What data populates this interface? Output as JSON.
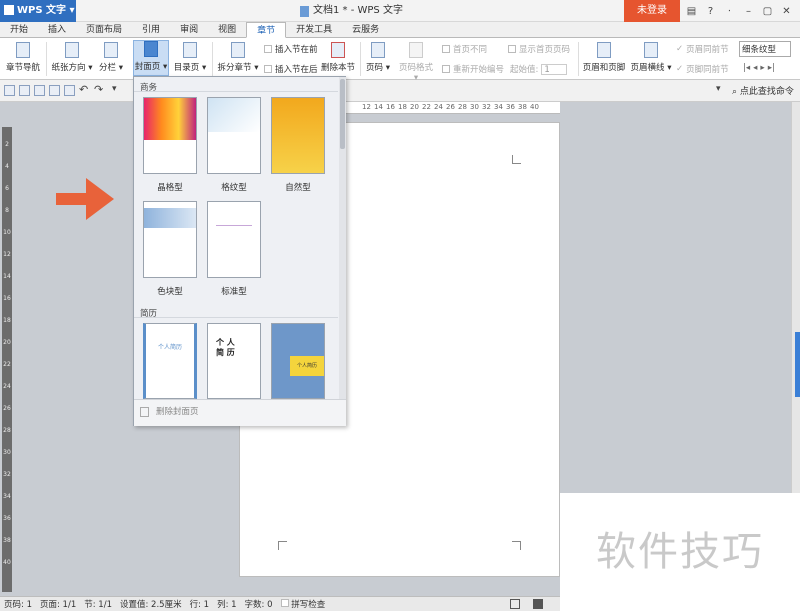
{
  "titlebar": {
    "app_name": "WPS 文字",
    "doc_title": "文档1 * - WPS 文字",
    "login": "未登录",
    "help": "?"
  },
  "tabs": [
    "开始",
    "插入",
    "页面布局",
    "引用",
    "审阅",
    "视图",
    "章节",
    "开发工具",
    "云服务"
  ],
  "active_tab": "章节",
  "ribbon": {
    "nav": "章节导航",
    "orientation": "纸张方向",
    "columns": "分栏",
    "cover": "封面页",
    "toc": "目录页",
    "split": "拆分章节",
    "insert_before": "插入节在前",
    "insert_after": "插入节在后",
    "delete_section": "删除本节",
    "page_num": "页码",
    "page_num_format": "页码格式",
    "first_page_diff": "首页不同",
    "show_first_page_num": "显示首页页码",
    "restart_numbering": "重新开始编号",
    "start_value_label": "起始值:",
    "start_value": "1",
    "header_footer": "页眉和页脚",
    "header_line": "页眉横线",
    "same_as_prev_header": "页眉同前节",
    "same_as_prev_footer": "页脚同前节",
    "style_value": "细条纹型"
  },
  "quickbar": {
    "search_command": "点此查找命令"
  },
  "ruler": {
    "h_marks": [
      "12",
      "14",
      "16",
      "18",
      "20",
      "22",
      "24",
      "26",
      "28",
      "30",
      "32",
      "34",
      "36",
      "38",
      "40"
    ],
    "v_marks": [
      "2",
      "4",
      "6",
      "8",
      "10",
      "12",
      "14",
      "16",
      "18",
      "20",
      "22",
      "24",
      "26",
      "28",
      "30",
      "32",
      "34",
      "36",
      "38",
      "40"
    ]
  },
  "dropdown": {
    "group1": "商务",
    "group2": "简历",
    "items": [
      {
        "label": "晶格型"
      },
      {
        "label": "格纹型"
      },
      {
        "label": "自然型"
      },
      {
        "label": "色块型"
      },
      {
        "label": "标准型"
      }
    ],
    "resume_items": [
      {
        "text": "个人简历"
      },
      {
        "text": "个 人 简 历"
      },
      {
        "text": "个人简历"
      }
    ],
    "delete_cover": "删除封面页"
  },
  "statusbar": {
    "page_num": "页码: 1",
    "pages": "页面: 1/1",
    "section": "节: 1/1",
    "position": "设置值: 2.5厘米",
    "line": "行: 1",
    "column": "列: 1",
    "words": "字数: 0",
    "spell": "拼写检查"
  },
  "watermark": "软件技巧",
  "colors": {
    "accent": "#2f6fc0",
    "login_bg": "#e6552f",
    "arrow": "#e8623a"
  }
}
